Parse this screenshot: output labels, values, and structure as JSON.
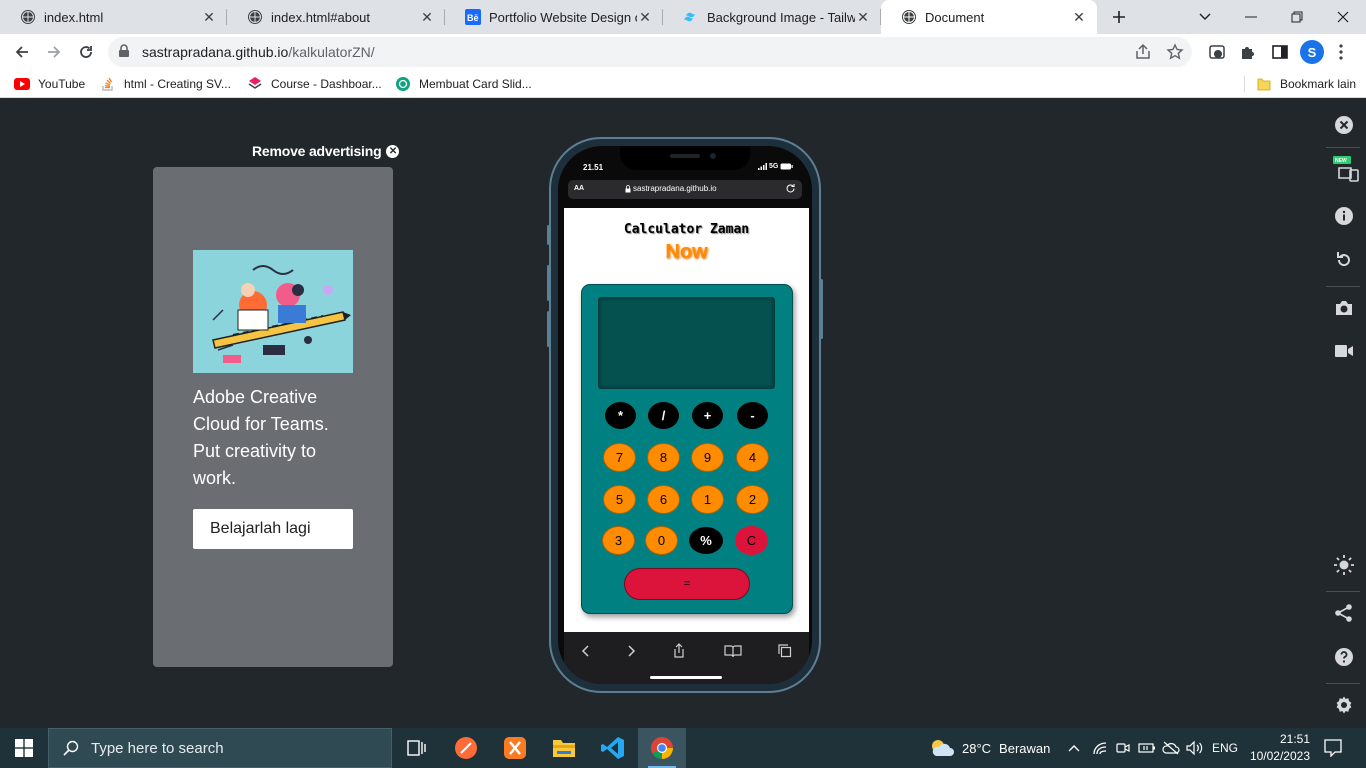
{
  "browser": {
    "tabs": [
      {
        "title": "index.html",
        "icon": "globe-icon",
        "active": false
      },
      {
        "title": "index.html#about",
        "icon": "globe-icon",
        "active": false
      },
      {
        "title": "Portfolio Website Design on B",
        "icon": "behance-icon",
        "active": false
      },
      {
        "title": "Background Image - Tailwind",
        "icon": "tailwind-icon",
        "active": false
      },
      {
        "title": "Document",
        "icon": "globe-icon",
        "active": true
      }
    ],
    "url_host": "sastrapradana.github.io",
    "url_path": "/kalkulatorZN/",
    "profile_initial": "S",
    "bookmarks": [
      {
        "label": "YouTube",
        "icon": "youtube-icon"
      },
      {
        "label": "html - Creating SV...",
        "icon": "stackoverflow-icon"
      },
      {
        "label": "Course - Dashboar...",
        "icon": "course-icon"
      },
      {
        "label": "Membuat Card Slid...",
        "icon": "chatgpt-icon"
      }
    ],
    "other_bookmarks": "Bookmark lain"
  },
  "ad": {
    "remove_label": "Remove advertising",
    "headline": "Adobe Creative Cloud for Teams. Put creativity to work.",
    "button": "Belajarlah lagi",
    "panel_color": "#6a6d72"
  },
  "phone": {
    "time": "21.51",
    "network": "5G",
    "safari_aa": "AA",
    "safari_url": "sastrapradana.github.io",
    "app": {
      "title": "Calculator Zaman",
      "subtitle": "Now",
      "accent_orange": "#ff8c00",
      "teal": "#008080",
      "crimson": "#dc143c",
      "operator_keys": [
        "*",
        "/",
        "+",
        "-"
      ],
      "row1": [
        "7",
        "8",
        "9",
        "4"
      ],
      "row2": [
        "5",
        "6",
        "1",
        "2"
      ],
      "row3": [
        "3",
        "0",
        "%",
        "C"
      ],
      "equals": "="
    }
  },
  "taskbar": {
    "search_placeholder": "Type here to search",
    "weather_temp": "28°C",
    "weather_desc": "Berawan",
    "lang": "ENG",
    "clock_time": "21:51",
    "clock_date": "10/02/2023"
  }
}
